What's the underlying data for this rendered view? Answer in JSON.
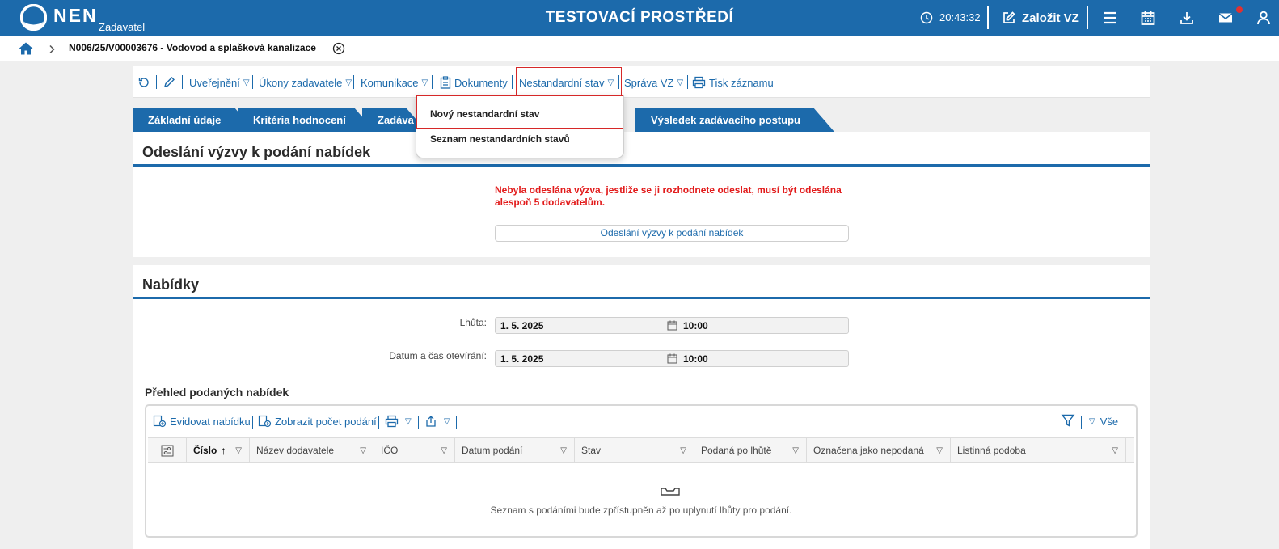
{
  "header": {
    "logo_text": "NEN",
    "logo_sub": "Zadavatel",
    "env_title": "TESTOVACÍ PROSTŘEDÍ",
    "time": "20:43:32",
    "new_vz_label": "Založit VZ"
  },
  "breadcrumb": {
    "text": "N006/25/V00003676 - Vodovod a splašková kanalizace"
  },
  "toolbar": {
    "items": [
      "Uveřejnění",
      "Úkony zadavatele",
      "Komunikace",
      "Dokumenty",
      "Nestandardní stav",
      "Správa VZ",
      "Tisk záznamu"
    ]
  },
  "dropdown": {
    "items": [
      "Nový nestandardní stav",
      "Seznam nestandardních stavů"
    ]
  },
  "tabs": [
    "Základní údaje",
    "Kritéria hodnocení",
    "Zadáva",
    "Výsledek zadávacího postupu"
  ],
  "invitation": {
    "title": "Odeslání výzvy k podání nabídek",
    "warning": "Nebyla odeslána výzva, jestliže se ji rozhodnete odeslat, musí být odeslána alespoň 5 dodavatelům.",
    "button": "Odeslání výzvy k podání nabídek"
  },
  "offers": {
    "title": "Nabídky",
    "deadline_label": "Lhůta:",
    "deadline_date": "1. 5. 2025",
    "deadline_time": "10:00",
    "opening_label": "Datum a čas otevírání:",
    "opening_date": "1. 5. 2025",
    "opening_time": "10:00",
    "overview_title": "Přehled podaných nabídek"
  },
  "grid": {
    "toolbar": {
      "record_label": "Evidovat nabídku",
      "count_label": "Zobrazit počet podání",
      "filter_all": "Vše"
    },
    "columns": [
      "Číslo",
      "Název dodavatele",
      "IČO",
      "Datum podání",
      "Stav",
      "Podaná po lhůtě",
      "Označena jako nepodaná",
      "Listinná podoba"
    ],
    "empty_text": "Seznam s podáními bude zpřístupněn až po uplynutí lhůty pro podání."
  },
  "colors": {
    "primary": "#1c6aab",
    "warning": "#e21b1b",
    "highlight": "#d62828"
  }
}
